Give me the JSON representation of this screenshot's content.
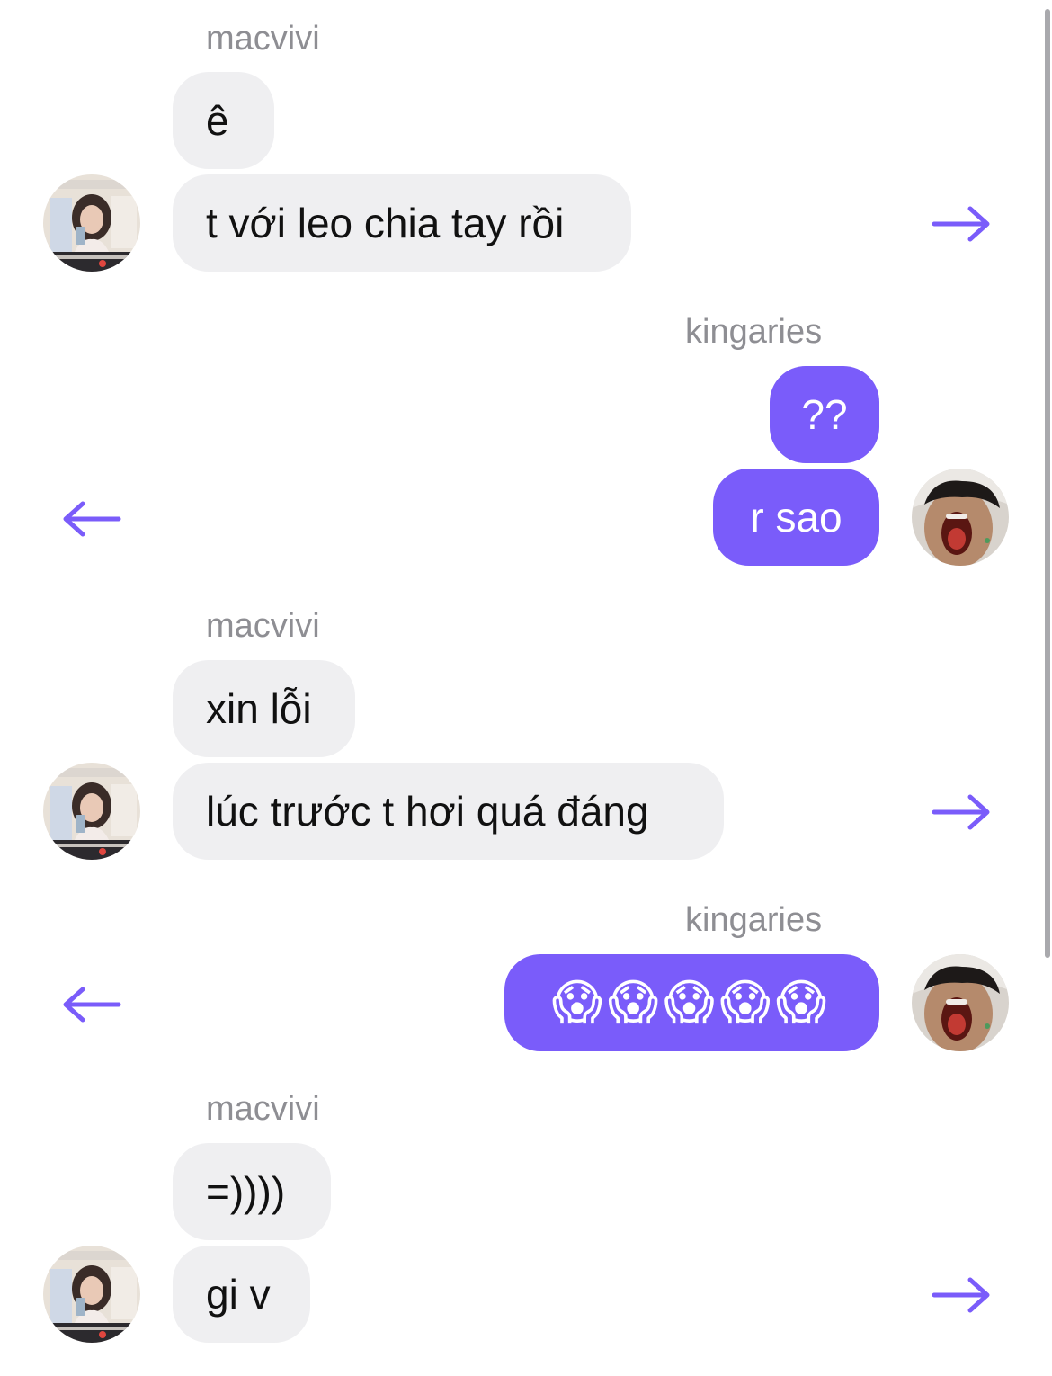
{
  "colors": {
    "accent": "#7a5cfa",
    "incoming_bubble": "#efeff1",
    "sender_label": "#8e8e93"
  },
  "groups": [
    {
      "sender": "macvivi",
      "direction": "incoming",
      "messages": [
        "ê",
        "t với leo chia tay rồi"
      ],
      "swipe_icon": "arrow-right-icon"
    },
    {
      "sender": "kingaries",
      "direction": "outgoing",
      "messages": [
        "??",
        "r sao"
      ],
      "swipe_icon": "arrow-left-icon"
    },
    {
      "sender": "macvivi",
      "direction": "incoming",
      "messages": [
        "xin lỗi",
        "lúc trước t hơi quá đáng"
      ],
      "swipe_icon": "arrow-right-icon"
    },
    {
      "sender": "kingaries",
      "direction": "outgoing",
      "messages": [
        "😱😱😱😱😱"
      ],
      "swipe_icon": "arrow-left-icon"
    },
    {
      "sender": "macvivi",
      "direction": "incoming",
      "messages": [
        "=))))",
        "gi v"
      ],
      "swipe_icon": "arrow-right-icon"
    }
  ]
}
